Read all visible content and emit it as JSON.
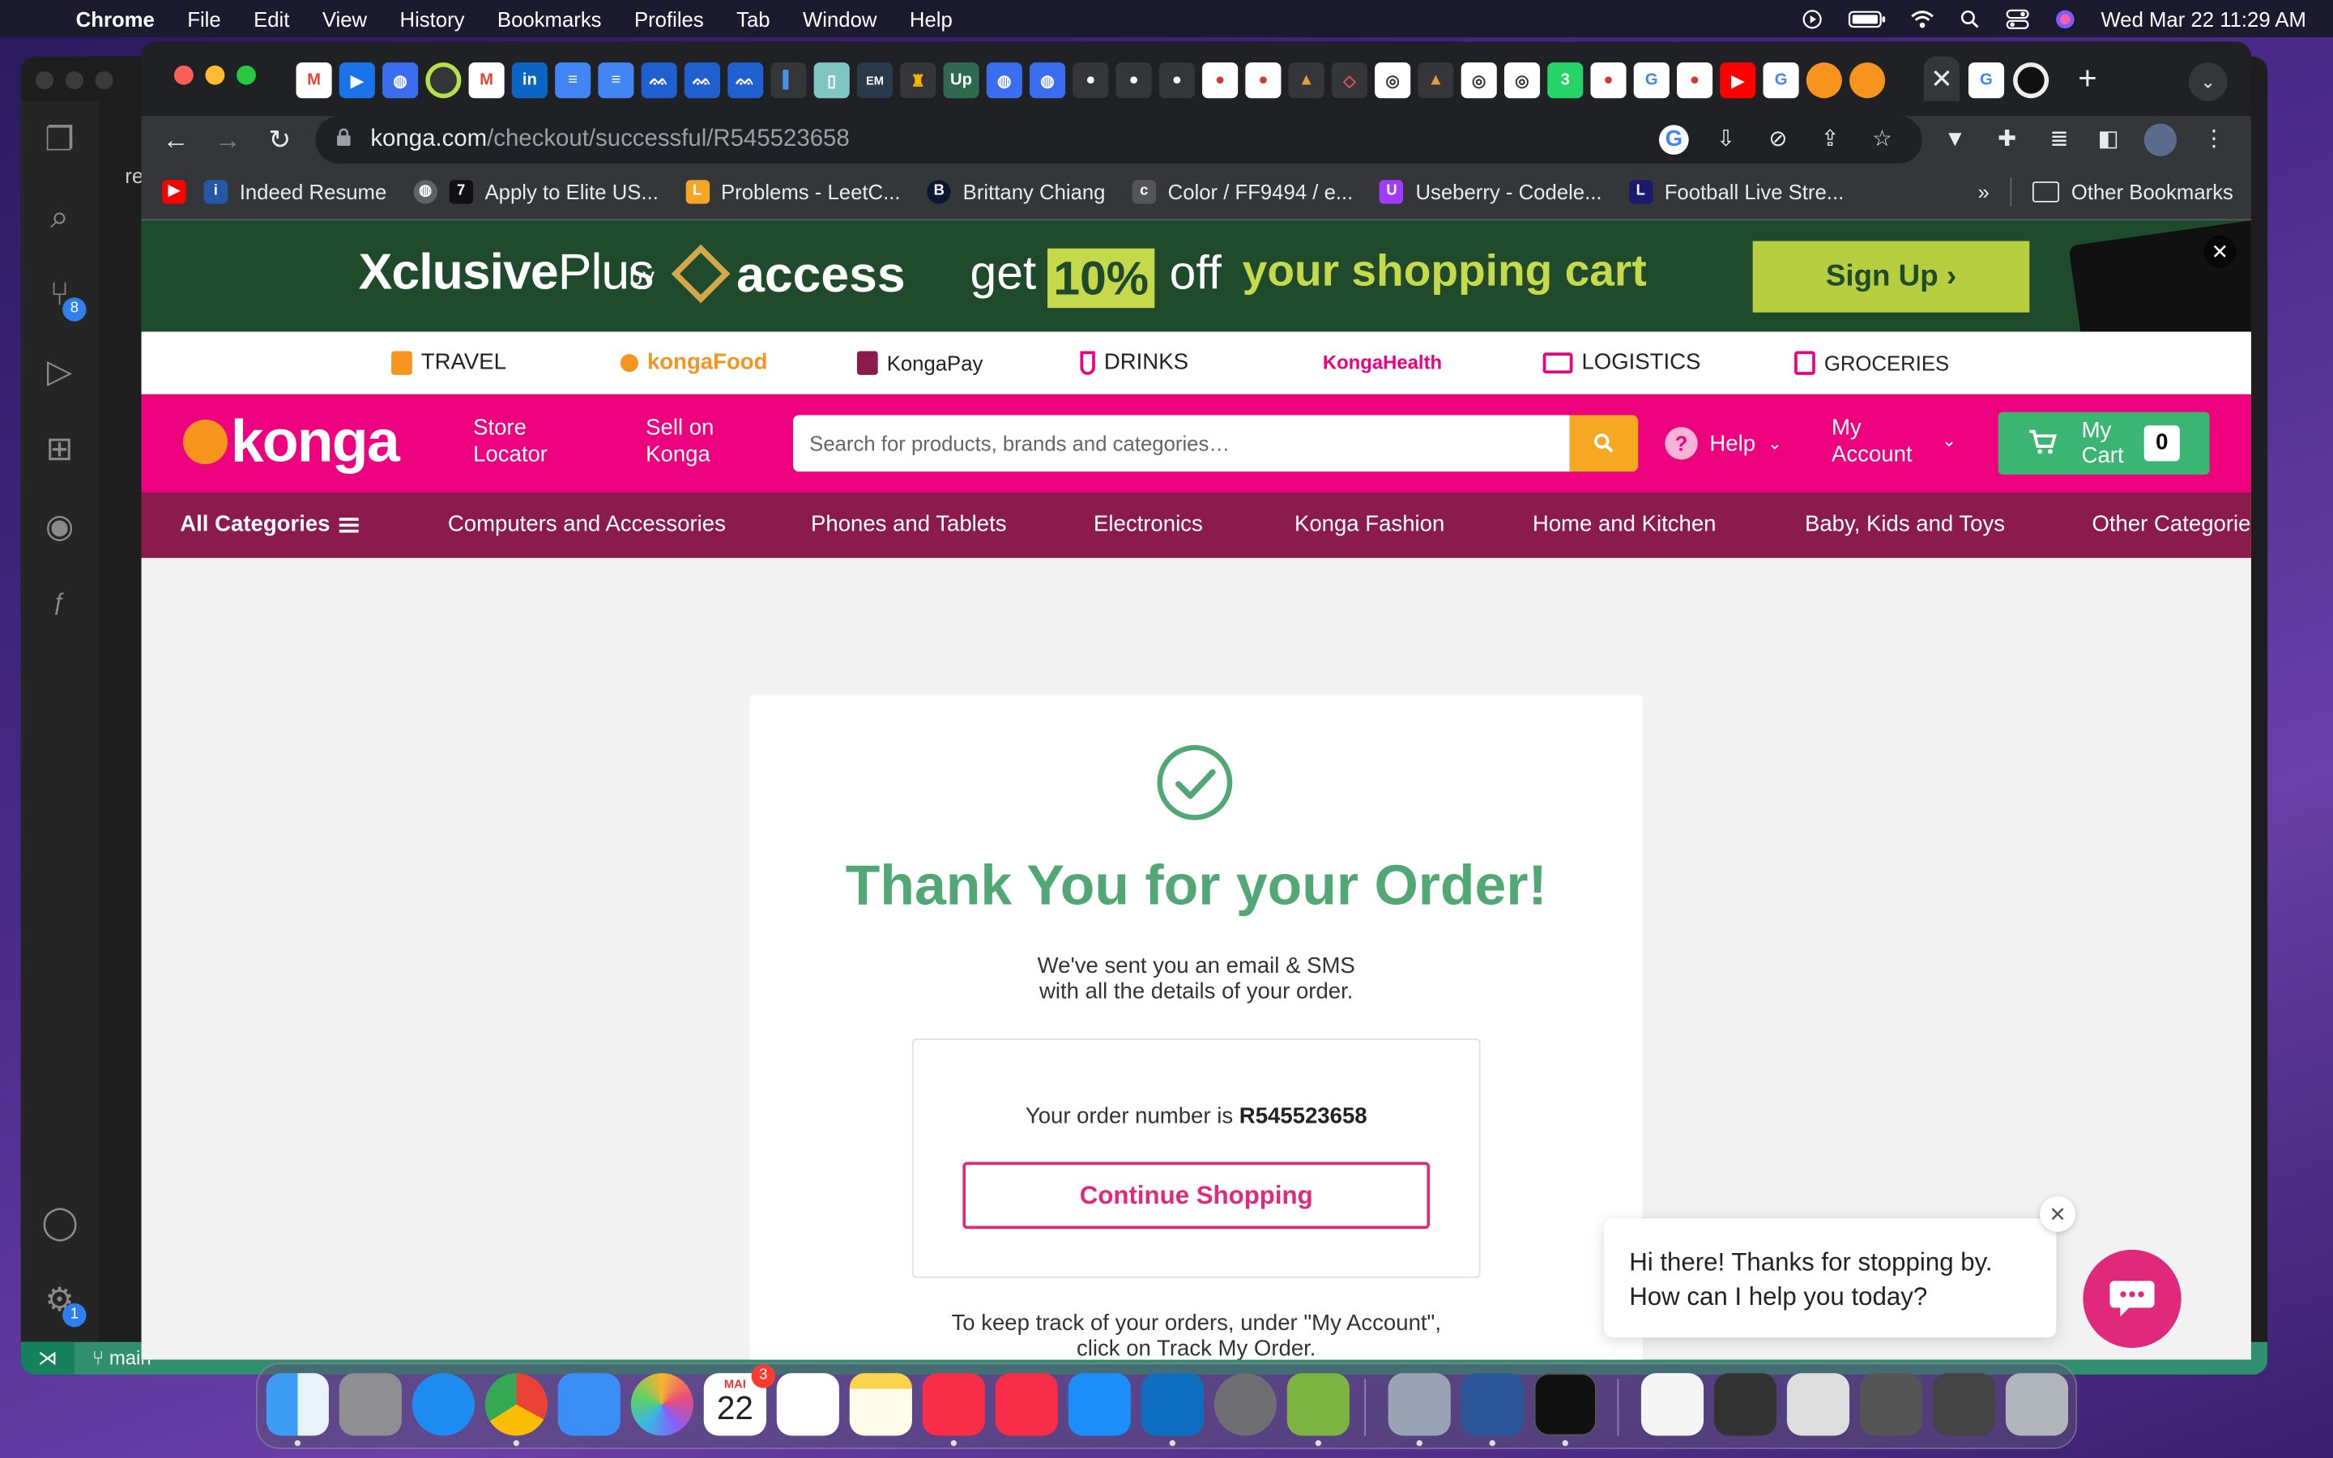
{
  "menubar": {
    "app": "Chrome",
    "items": [
      "File",
      "Edit",
      "View",
      "History",
      "Bookmarks",
      "Profiles",
      "Tab",
      "Window",
      "Help"
    ],
    "datetime": "Wed Mar 22  11:29 AM"
  },
  "vscode": {
    "tab_fragment": "re",
    "branch": "main",
    "scm_badge": "8",
    "settings_badge": "1"
  },
  "browser": {
    "url_host": "konga.com",
    "url_path": "/checkout/successful/R545523658",
    "bookmarks": [
      {
        "label": "Indeed Resume",
        "color": "#2557a7",
        "fav": "i"
      },
      {
        "label": "Apply to Elite US...",
        "color": "#111111",
        "fav": "7"
      },
      {
        "label": "Problems - LeetC...",
        "color": "#f5a623",
        "fav": "L"
      },
      {
        "label": "Brittany Chiang",
        "color": "#0a192f",
        "fav": "B"
      },
      {
        "label": "Color / FF9494 / e...",
        "color": "#555555",
        "fav": "c"
      },
      {
        "label": "Useberry - Codele...",
        "color": "#a03cff",
        "fav": "U"
      },
      {
        "label": "Football Live Stre...",
        "color": "#1a1a6e",
        "fav": "L"
      }
    ],
    "bookmarks_more": "»",
    "other_bookmarks": "Other Bookmarks"
  },
  "promo": {
    "brand_a": "Xclusive",
    "brand_b": "Plus",
    "by": "by",
    "access": "access",
    "get": "get",
    "percent": "10%",
    "off": "off",
    "tagline": "your shopping cart",
    "cta": "Sign Up ›"
  },
  "services": [
    {
      "label": "TRAVEL"
    },
    {
      "label": "kongaFood"
    },
    {
      "label": "KongaPay"
    },
    {
      "label": "DRINKS"
    },
    {
      "label": "KongaHealth"
    },
    {
      "label": "LOGISTICS"
    },
    {
      "label": "GROCERIES"
    }
  ],
  "header": {
    "logo": "konga",
    "store_locator": [
      "Store",
      "Locator"
    ],
    "sell_on": [
      "Sell on",
      "Konga"
    ],
    "search_placeholder": "Search for products, brands and categories…",
    "help": "Help",
    "account": [
      "My",
      "Account"
    ],
    "cart": [
      "My",
      "Cart"
    ],
    "cart_count": "0"
  },
  "categories": {
    "all": "All Categories",
    "items": [
      "Computers and Accessories",
      "Phones and Tablets",
      "Electronics",
      "Konga Fashion",
      "Home and Kitchen",
      "Baby, Kids and Toys",
      "Other Categories"
    ]
  },
  "confirmation": {
    "title": "Thank You for your Order!",
    "sent_line1": "We've sent you an email & SMS",
    "sent_line2": "with all the details of your order.",
    "order_prefix": "Your order number is",
    "order_number": "R545523658",
    "continue": "Continue Shopping",
    "track_line1": "To keep track of your orders, under \"My Account\",",
    "track_line2": "click on Track My Order."
  },
  "chat": {
    "line1": "Hi there! Thanks for stopping by.",
    "line2": "How can I help you today?"
  },
  "dock": {
    "calendar_month": "MAI",
    "calendar_day": "22",
    "calendar_badge": "3"
  },
  "colors": {
    "konga_pink": "#ed017f",
    "category_bar": "#8b1a4d",
    "success_green": "#52a875",
    "cart_green": "#3ab572"
  }
}
